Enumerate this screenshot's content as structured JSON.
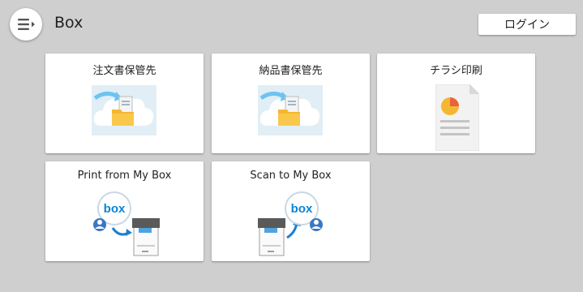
{
  "header": {
    "title": "Box",
    "login_label": "ログイン",
    "menu_icon": "hamburger-menu-icon"
  },
  "tiles": [
    {
      "label": "注文書保管先",
      "icon": "cloud-folder-icon"
    },
    {
      "label": "納品書保管先",
      "icon": "cloud-folder-icon"
    },
    {
      "label": "チラシ印刷",
      "icon": "document-chart-icon"
    },
    {
      "label": "Print from My Box",
      "icon": "box-to-printer-icon"
    },
    {
      "label": "Scan to My Box",
      "icon": "printer-to-box-icon"
    }
  ],
  "colors": {
    "background": "#cfcfcf",
    "box_brand": "#0a84d6",
    "folder": "#f5b731",
    "arrow": "#6ec3f0"
  }
}
